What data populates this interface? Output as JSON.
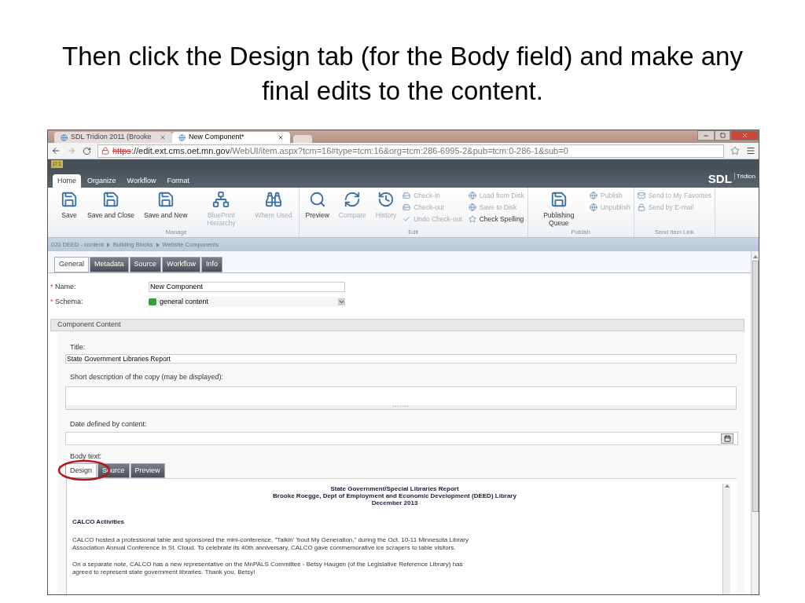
{
  "slide_title": "Then click the Design tab (for the Body field) and make any final edits to the content.",
  "browser": {
    "tabs": [
      {
        "label": "SDL Tridion 2011 (Brooke",
        "selected": false
      },
      {
        "label": "New Component*",
        "selected": true
      }
    ],
    "url_scheme": "https",
    "url_host": "://edit.ext.cms.oet.mn.gov",
    "url_path": "/WebUI/item.aspx?tcm=16#type=tcm:16&org=tcm:286-6995-2&pub=tcm:0-286-1&sub=0"
  },
  "flag_label": "1",
  "ribbon_tabs": [
    {
      "label": "Home",
      "selected": true
    },
    {
      "label": "Organize",
      "selected": false
    },
    {
      "label": "Workflow",
      "selected": false
    },
    {
      "label": "Format",
      "selected": false
    }
  ],
  "logo": {
    "brand": "SDL",
    "product": "Tridion"
  },
  "ribbon_groups": [
    {
      "label": "Manage",
      "items": [
        {
          "kind": "large",
          "label": "Save",
          "disabled": false
        },
        {
          "kind": "large",
          "label": "Save and Close",
          "disabled": false
        },
        {
          "kind": "large",
          "label": "Save and New",
          "disabled": false
        },
        {
          "kind": "large",
          "label": "BluePrint Hierarchy",
          "disabled": true
        },
        {
          "kind": "large",
          "label": "Where Used",
          "disabled": true
        }
      ]
    },
    {
      "label": "Edit",
      "items": [
        {
          "kind": "large",
          "label": "Preview",
          "disabled": false
        },
        {
          "kind": "large",
          "label": "Compare",
          "disabled": true
        },
        {
          "kind": "large",
          "label": "History",
          "disabled": true
        },
        {
          "kind": "small",
          "label": "Check-in",
          "disabled": true
        },
        {
          "kind": "small",
          "label": "Check-out",
          "disabled": true
        },
        {
          "kind": "small",
          "label": "Undo Check-out",
          "disabled": true
        },
        {
          "kind": "small",
          "label": "Load from Disk",
          "disabled": true
        },
        {
          "kind": "small",
          "label": "Save to Disk",
          "disabled": true
        },
        {
          "kind": "small",
          "label": "Check Spelling",
          "disabled": false
        }
      ]
    },
    {
      "label": "Publish",
      "items": [
        {
          "kind": "large",
          "label": "Publishing Queue",
          "disabled": false
        },
        {
          "kind": "small",
          "label": "Publish",
          "disabled": true
        },
        {
          "kind": "small",
          "label": "Unpublish",
          "disabled": true
        }
      ]
    },
    {
      "label": "Send Item Link",
      "items": [
        {
          "kind": "small",
          "label": "Send to My Favorites",
          "disabled": true
        },
        {
          "kind": "small",
          "label": "Send by E-mail",
          "disabled": true
        }
      ]
    }
  ],
  "breadcrumb": [
    "020 DEED - content",
    "Building Blocks",
    "Website Components"
  ],
  "item_tabs": [
    {
      "label": "General",
      "selected": true
    },
    {
      "label": "Metadata",
      "selected": false
    },
    {
      "label": "Source",
      "selected": false
    },
    {
      "label": "Workflow",
      "selected": false
    },
    {
      "label": "Info",
      "selected": false
    }
  ],
  "fields": [
    {
      "marker": "*",
      "label": "Name:",
      "value": "New Component",
      "kind": "text"
    },
    {
      "marker": "*",
      "label": "Schema:",
      "value": "general content",
      "kind": "select"
    }
  ],
  "section_title": "Component Content",
  "content_fields": {
    "title_label": "Title:",
    "title_value": "State Government Libraries Report",
    "description_label": "Short description of the copy (may be displayed):",
    "date_label": "Date defined by content:",
    "body_label": "Body text:"
  },
  "body_tabs": [
    {
      "label": "Design",
      "selected": true
    },
    {
      "label": "Source",
      "selected": false
    },
    {
      "label": "Preview",
      "selected": false
    }
  ],
  "document": {
    "heading_lines": [
      "State Government/Special Libraries Report",
      "Brooke Roegge, Dept of Employment and Economic Development (DEED) Library",
      "December 2013"
    ],
    "section_heading": "CALCO Activities",
    "paragraphs": [
      "CALCO hosted a professional table and sponsored the mini-conference, \"Talkin' 'bout My Generation,\" during the Oct. 10-11 Minnesota Library Association Annual Conference in St. Cloud. To celebrate its 40th anniversary, CALCO gave commemorative ice scrapers to table visitors.",
      "On a separate note, CALCO has a new representative on the MnPALS Committee - Betsy Haugen (of the Legislative Reference Library) has agreed to represent state government libraries. Thank you, Betsy!"
    ]
  }
}
